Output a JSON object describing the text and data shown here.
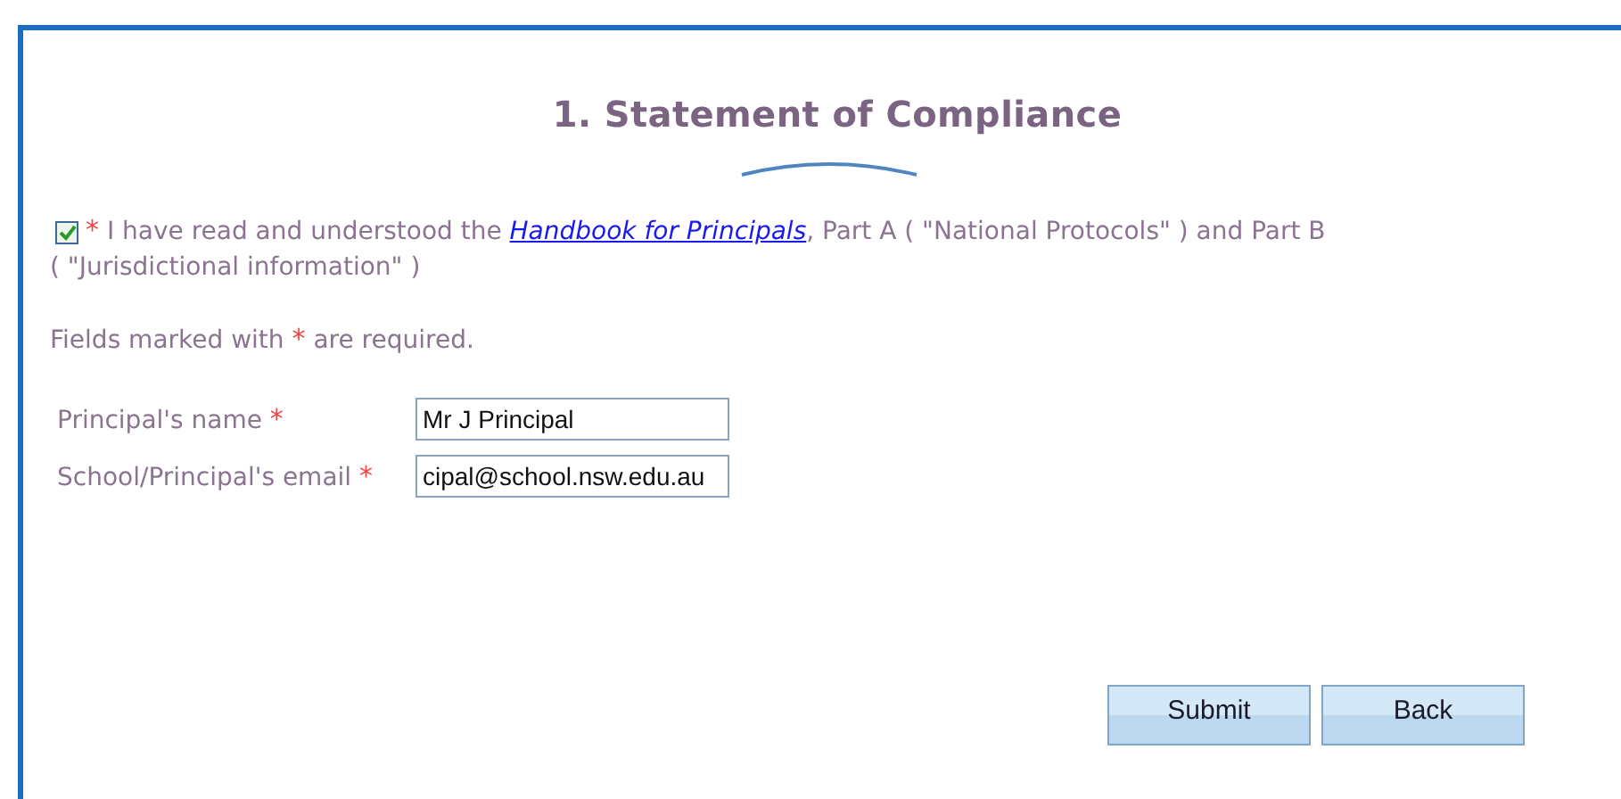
{
  "title": "1. Statement of Compliance",
  "consent": {
    "checked": true,
    "required_mark": "*",
    "text_before": "I have read and understood the ",
    "link": "Handbook for Principals",
    "text_after": ", Part A ( \"National Protocols\" ) and Part B",
    "text_line2": "( \"Jurisdictional information\" )"
  },
  "required_note": {
    "before": "Fields marked with ",
    "mark": "*",
    "after": " are required."
  },
  "fields": [
    {
      "label": "Principal's name",
      "required_mark": "*",
      "value": "Mr J Principal"
    },
    {
      "label": "School/Principal's email",
      "required_mark": "*",
      "value": "cipal@school.nsw.edu.au"
    }
  ],
  "buttons": [
    "Submit",
    "Back"
  ]
}
